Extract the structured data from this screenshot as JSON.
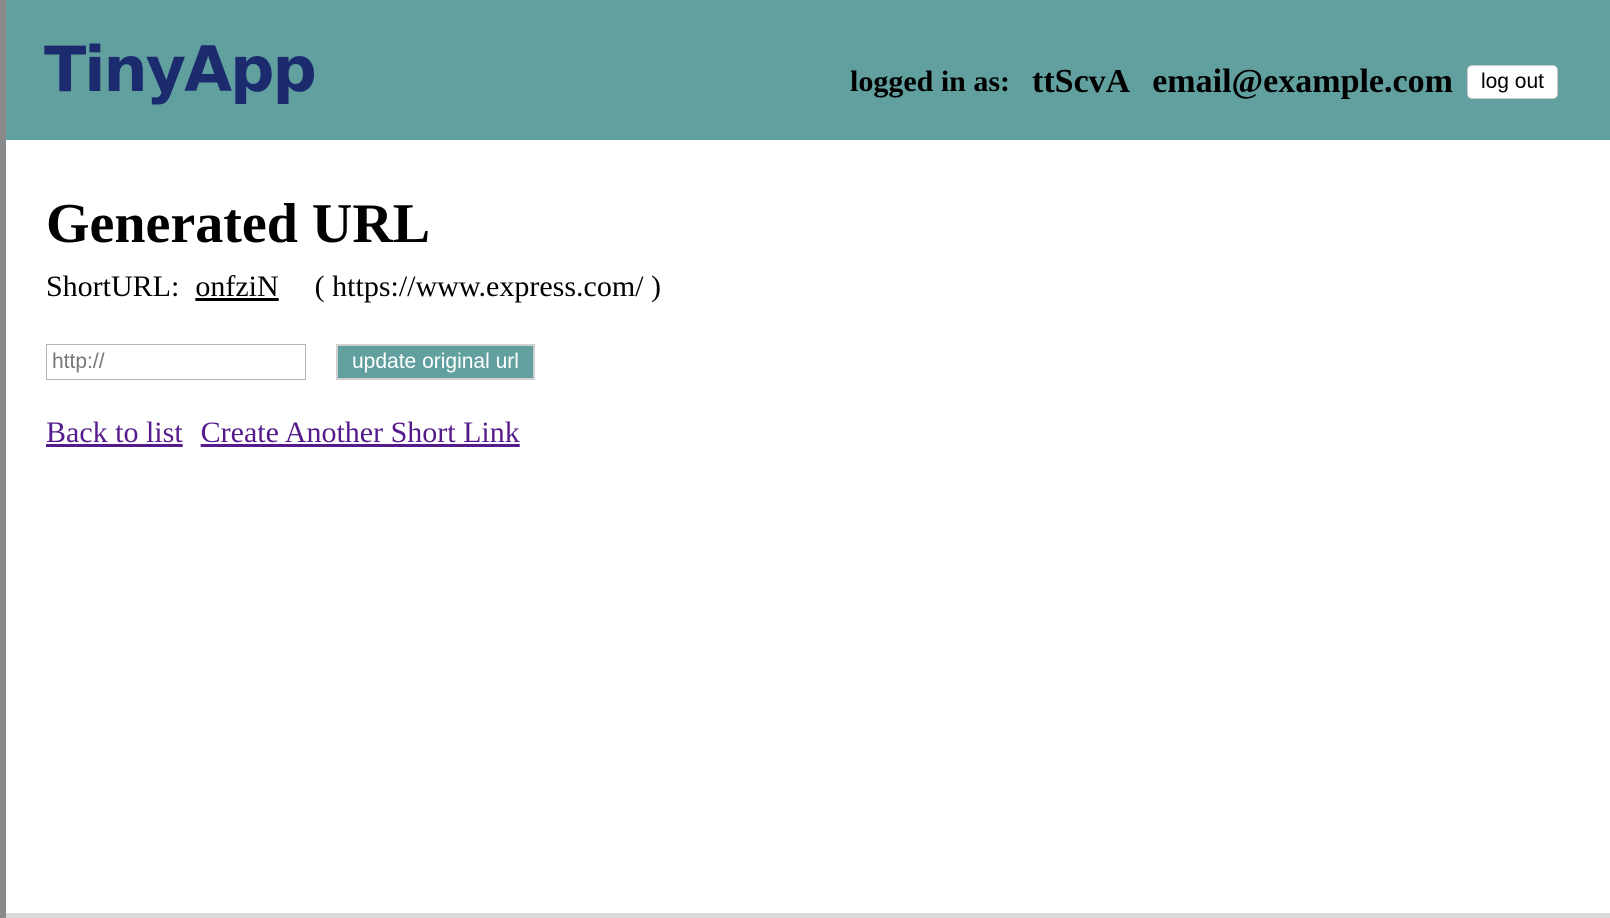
{
  "header": {
    "logo": "TinyApp",
    "logged_in_label": "logged in as:",
    "user_id": "ttScvA",
    "email": "email@example.com",
    "logout_label": "log out",
    "background_color": "#62a0a0",
    "logo_color": "#1c2b6e"
  },
  "main": {
    "title": "Generated URL",
    "short_url_label": "ShortURL:",
    "short_url_code": "onfziN",
    "long_url_display": "( https://www.express.com/ )",
    "input": {
      "placeholder": "http://",
      "value": ""
    },
    "update_button_label": "update original url",
    "links": {
      "back_to_list": "Back to list",
      "create_another": "Create Another Short Link"
    },
    "link_color": "#551a8b"
  }
}
